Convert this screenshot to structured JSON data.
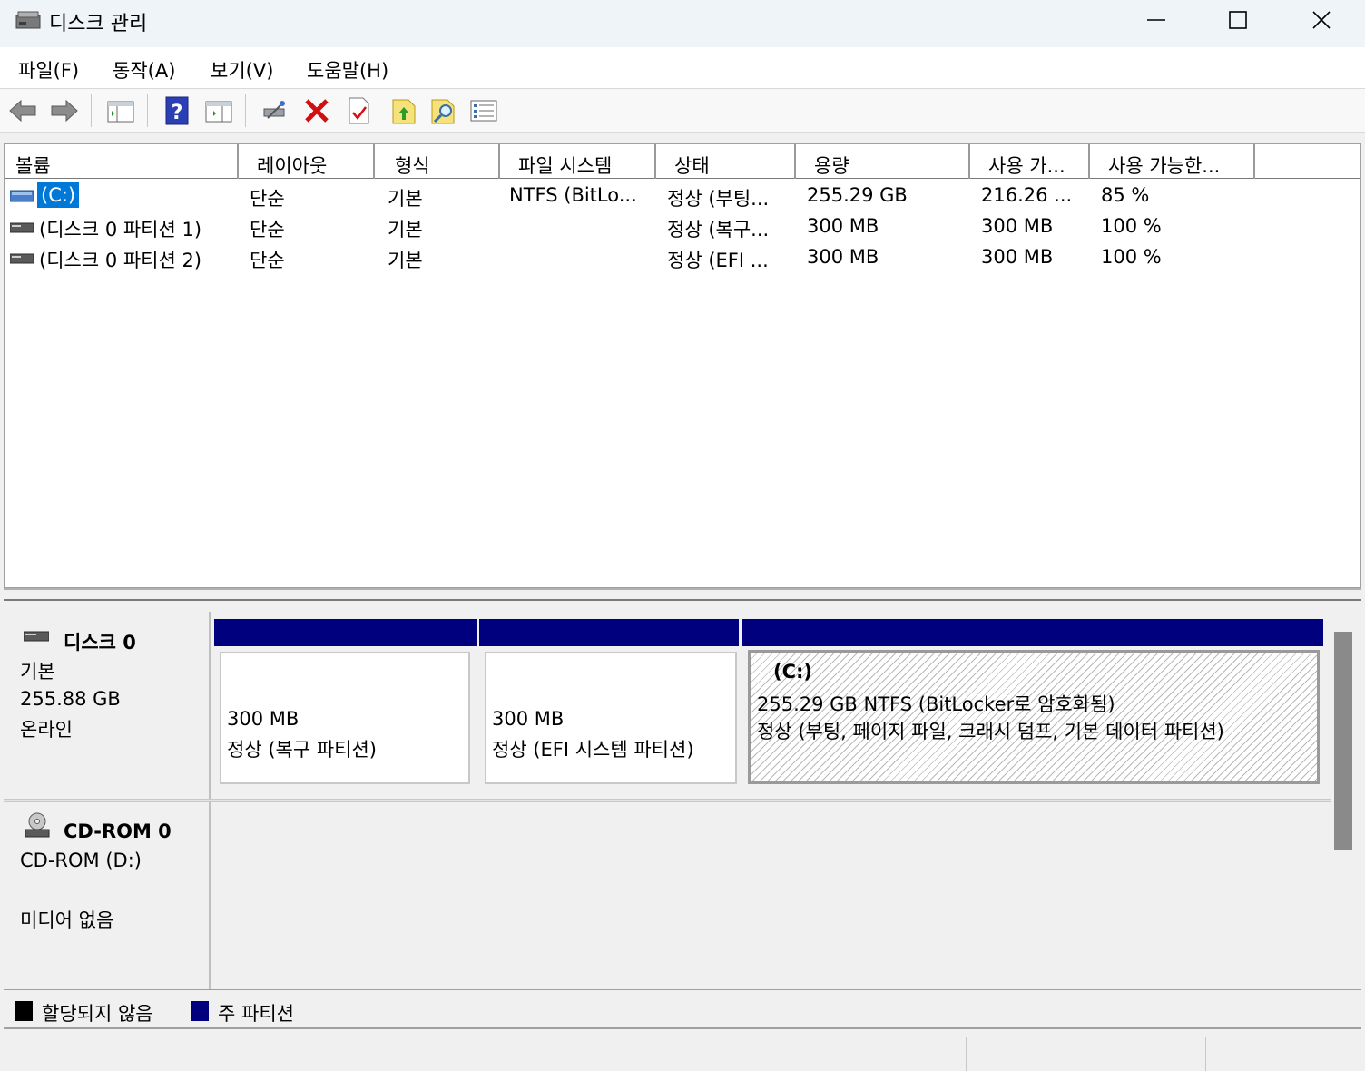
{
  "window": {
    "title": "디스크 관리",
    "minimize_glyph": "—",
    "maximize_glyph": "☐",
    "close_glyph": "✕"
  },
  "menu": {
    "items": [
      {
        "label": "파일(F)"
      },
      {
        "label": "동작(A)"
      },
      {
        "label": "보기(V)"
      },
      {
        "label": "도움말(H)"
      }
    ]
  },
  "toolbar": {
    "icons": [
      "back-icon",
      "forward-icon",
      "show-hide-console-tree-icon",
      "help-icon",
      "show-hide-action-pane-icon",
      "connect-drive-icon",
      "delete-icon",
      "properties-icon",
      "export-icon",
      "find-icon",
      "list-view-icon"
    ]
  },
  "volume_list": {
    "columns": [
      "볼륨",
      "레이아웃",
      "형식",
      "파일 시스템",
      "상태",
      "용량",
      "사용 가...",
      "사용 가능한..."
    ],
    "rows": [
      {
        "volume": "(C:)",
        "layout": "단순",
        "type": "기본",
        "fs": "NTFS (BitLo...",
        "status": "정상 (부팅...",
        "capacity": "255.29 GB",
        "free": "216.26 ...",
        "pct": "85 %",
        "selected": true
      },
      {
        "volume": "(디스크 0 파티션 1)",
        "layout": "단순",
        "type": "기본",
        "fs": "",
        "status": "정상 (복구...",
        "capacity": "300 MB",
        "free": "300 MB",
        "pct": "100 %",
        "selected": false
      },
      {
        "volume": "(디스크 0 파티션 2)",
        "layout": "단순",
        "type": "기본",
        "fs": "",
        "status": "정상 (EFI ...",
        "capacity": "300 MB",
        "free": "300 MB",
        "pct": "100 %",
        "selected": false
      }
    ]
  },
  "disks": {
    "disk0": {
      "name": "디스크 0",
      "type": "기본",
      "size": "255.88 GB",
      "state": "온라인",
      "partitions": [
        {
          "size": "300 MB",
          "status": "정상 (복구 파티션)"
        },
        {
          "size": "300 MB",
          "status": "정상 (EFI 시스템 파티션)"
        },
        {
          "label": "(C:)",
          "size": "255.29 GB NTFS (BitLocker로 암호화됨)",
          "status": "정상 (부팅, 페이지 파일, 크래시 덤프, 기본 데이터 파티션)"
        }
      ]
    },
    "cdrom0": {
      "name": "CD-ROM 0",
      "type": "CD-ROM (D:)",
      "state": "미디어 없음"
    }
  },
  "legend": {
    "items": [
      {
        "label": "할당되지 않음",
        "color": "#000000"
      },
      {
        "label": "주 파티션",
        "color": "#00007f"
      }
    ]
  },
  "colors": {
    "primary_partition": "#00007f",
    "selection": "#0078d7"
  }
}
